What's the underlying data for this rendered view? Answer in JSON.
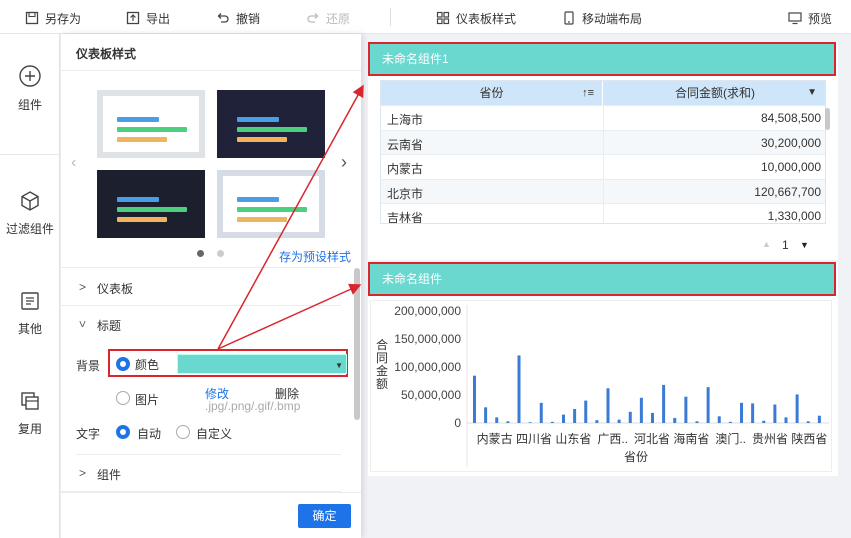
{
  "toolbar": {
    "save_as": "另存为",
    "export": "导出",
    "undo": "撤销",
    "redo": "还原",
    "dashboard_style": "仪表板样式",
    "mobile_layout": "移动端布局",
    "preview": "预览"
  },
  "nav": {
    "components": "组件",
    "filters": "过滤组件",
    "others": "其他",
    "reuse": "复用"
  },
  "panel": {
    "title": "仪表板样式",
    "save_preset": "存为预设样式",
    "sections": {
      "dashboard": "仪表板",
      "title": "标题",
      "component": "组件"
    },
    "background_label": "背景",
    "color_option": "颜色",
    "image_option": "图片",
    "modify": "修改",
    "delete": "删除",
    "image_formats": ".jpg/.png/.gif/.bmp",
    "text_label": "文字",
    "auto_option": "自动",
    "custom_option": "自定义",
    "confirm": "确定",
    "selected_color": "#6ad8cf",
    "carousel_page": 1,
    "carousel_total": 2
  },
  "table_widget": {
    "title": "未命名组件1",
    "columns": [
      "省份",
      "合同金额(求和)"
    ],
    "rows": [
      [
        "上海市",
        "84,508,500"
      ],
      [
        "云南省",
        "30,200,000"
      ],
      [
        "内蒙古",
        "10,000,000"
      ],
      [
        "北京市",
        "120,667,700"
      ],
      [
        "吉林省",
        "1,330,000"
      ]
    ],
    "page": "1"
  },
  "chart_widget": {
    "title": "未命名组件",
    "chart_data": {
      "type": "bar",
      "ylabel": "合同金额",
      "xlabel": "省份",
      "y_ticks": [
        "200,000,000",
        "150,000,000",
        "100,000,000",
        "50,000,000",
        "0"
      ],
      "ylim": [
        0,
        200000000
      ],
      "x_tick_labels": [
        "内蒙古",
        "四川省",
        "山东省",
        "广西..",
        "河北省",
        "海南省",
        "澳门..",
        "贵州省",
        "陕西省"
      ],
      "values": [
        84508500,
        28000000,
        10000000,
        3000000,
        120667700,
        1330000,
        36000000,
        2000000,
        15000000,
        25000000,
        40000000,
        5000000,
        62000000,
        6000000,
        20000000,
        45000000,
        18000000,
        68000000,
        9000000,
        47000000,
        3000000,
        64000000,
        12000000,
        2000000,
        36000000,
        35000000,
        4000000,
        33000000,
        10000000,
        51000000,
        3000000,
        13000000
      ],
      "color": "#3a7bd5"
    }
  },
  "colors": {
    "accent": "#1e73e8",
    "highlight_border": "#d9252d",
    "header_bg": "#6ad8cf"
  }
}
